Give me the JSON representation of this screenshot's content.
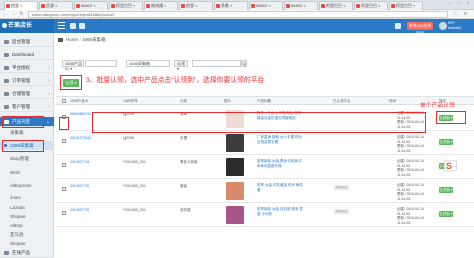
{
  "browser": {
    "tabs": [
      "拾里 ×",
      "货源 ×",
      "5680Z ×",
      "阿里巴巴 ×",
      "物流通 ×",
      "拾里 ×",
      "多数 ×",
      "5680Z ×",
      "5680Z ×",
      "阿里巴巴 ×",
      "阿里巴巴 ×",
      "阿里巴巴 ×"
    ],
    "url": "www.mangoerp.com/erp/#/erp/ali1688/product"
  },
  "app": {
    "logo": "芒果店长",
    "qq_button": "联系QQ在线客服",
    "user_name": "EKF",
    "user_sub": "test4464"
  },
  "sidebar": {
    "items": [
      {
        "label": "后台管理",
        "active": false
      },
      {
        "label": "Dashboard",
        "active": false
      },
      {
        "label": "平台授权",
        "active": false
      },
      {
        "label": "订单管理",
        "active": false
      },
      {
        "label": "仓储管理",
        "active": false
      },
      {
        "label": "客户管理",
        "active": false
      },
      {
        "label": "产品刊登",
        "active": true
      }
    ],
    "subitems": [
      "采集箱",
      "1688采集箱",
      "ebay管理",
      "Wish",
      "AliExpress",
      "Joom",
      "Lazada",
      "Shopee",
      "AliExp",
      "亚马逊",
      "Shopee"
    ],
    "bottom_item": "在线产品"
  },
  "breadcrumb": {
    "home": "Home",
    "current": "1688采集箱"
  },
  "filters": {
    "all_label": "1688产品ID ▾",
    "id_placeholder": "",
    "search_type": "1688采集箱",
    "status": "认领 ▾",
    "search_btn": "Q"
  },
  "actions": {
    "batch_claim": "认领 ▾"
  },
  "annotations": {
    "main": "3、批量认领，选中产品点击“认领到”，选择你要认领的平台",
    "single": "单个产品认领"
  },
  "table": {
    "headers": [
      "1688产品ID",
      "1688货号",
      "分类",
      "图片",
      "产品标题",
      "已认领平台",
      "时间",
      "操作"
    ],
    "rows": [
      {
        "id": "55024860721",
        "sku": "zjj2936",
        "cat": "翡翠",
        "title": "配件一个女士 吊坠饰品 首饰 镀金合金仿宝石项链精品",
        "shop": "",
        "time": "创建: 2016-05-14 11:14:52\n更新: 2016-05-14 11:14:52",
        "claim": "认领到 ▾",
        "thumb": "#f0dbd4"
      },
      {
        "id": "40101275161",
        "sku": "zjj2936",
        "cat": "手镯",
        "title": "厂家直销 新款 女士手镯 时尚百搭金属手镯",
        "shop": "",
        "time": "创建: 2016-05-14 11:14:52\n更新: 2016-05-14 11:14:52",
        "claim": "认领到 ▾",
        "thumb": "#3c3c3c"
      },
      {
        "id": "4010527744",
        "sku": "YSD1565_201",
        "cat": "黑色卡其裤",
        "title": "夏季新款 女装 黑色卡其裤 时尚休闲显瘦长裤",
        "shop": "",
        "time": "创建: 2016-05-14 11:14:52\n更新: 2016-05-14 11:14:52",
        "claim": "认领到 ▾",
        "thumb": "#2b2b2b"
      },
      {
        "id": "4010527739",
        "sku": "YSD1565_201",
        "cat": "套装",
        "title": "夏季 女装 印花套装 时尚 两件套",
        "shop": "Shopee",
        "time": "创建: 2016-05-14 11:14:52\n更新: 2016-05-14 11:14:52",
        "claim": "认领到 ▾",
        "thumb": "#d88a6a"
      },
      {
        "id": "4010527735",
        "sku": "YSD1565_201",
        "cat": "连衣裙",
        "title": "夏季新款 女装 连衣裙 修身 显瘦 中长款",
        "shop": "Shopee",
        "time": "创建: 2016-05-14 11:14:52\n更新: 2016-05-14 11:14:52",
        "claim": "认领到 ▾",
        "thumb": "#a7548a"
      }
    ]
  }
}
